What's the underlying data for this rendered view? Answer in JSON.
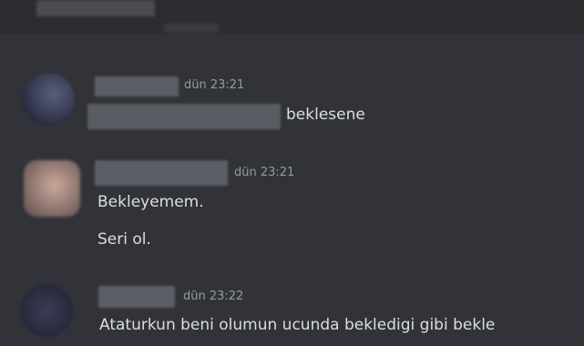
{
  "messages": [
    {
      "timestamp": "dün 23:21",
      "lines": [
        "beklesene"
      ]
    },
    {
      "timestamp": "dün 23:21",
      "lines": [
        "Bekleyemem.",
        "Seri ol."
      ]
    },
    {
      "timestamp": "dün 23:22",
      "lines": [
        "Ataturkun beni olumun ucunda bekledigi gibi bekle"
      ]
    }
  ]
}
